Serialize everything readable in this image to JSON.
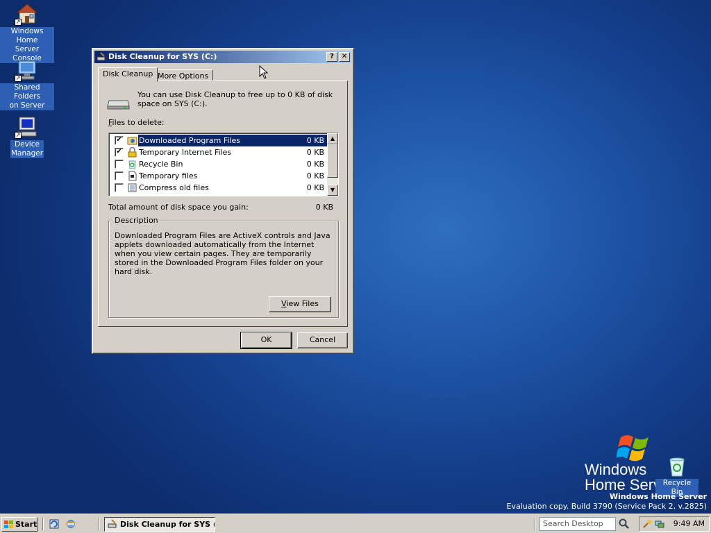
{
  "desktop": {
    "icons": [
      {
        "label_line1": "Windows Home",
        "label_line2": "Server Console"
      },
      {
        "label_line1": "Shared Folders",
        "label_line2": "on Server"
      },
      {
        "label_line1": "Device",
        "label_line2": "Manager"
      }
    ],
    "recycle_bin_label": "Recycle Bin",
    "brand": {
      "windows": "Windows",
      "home_server": "Home Server",
      "product": "Windows Home Server",
      "build": "Evaluation copy. Build 3790 (Service Pack 2, v.2825)"
    }
  },
  "dialog": {
    "title": "Disk Cleanup for SYS (C:)",
    "help_button": "?",
    "close_button": "✕",
    "tabs": [
      {
        "label": "Disk Cleanup",
        "active": true
      },
      {
        "label": "More Options",
        "active": false
      }
    ],
    "intro_text": "You can use Disk Cleanup to free up to 0 KB of disk space on SYS (C:).",
    "files_label": "Files to delete:",
    "files": [
      {
        "name": "Downloaded Program Files",
        "size": "0 KB",
        "checked": true,
        "selected": true
      },
      {
        "name": "Temporary Internet Files",
        "size": "0 KB",
        "checked": true,
        "selected": false
      },
      {
        "name": "Recycle Bin",
        "size": "0 KB",
        "checked": false,
        "selected": false
      },
      {
        "name": "Temporary files",
        "size": "0 KB",
        "checked": false,
        "selected": false
      },
      {
        "name": "Compress old files",
        "size": "0 KB",
        "checked": false,
        "selected": false
      }
    ],
    "total_label": "Total amount of disk space you gain:",
    "total_value": "0 KB",
    "description_legend": "Description",
    "description_text": "Downloaded Program Files are ActiveX controls and Java applets downloaded automatically from the Internet when you view certain pages. They are temporarily stored in the Downloaded Program Files folder on your hard disk.",
    "view_files_button": "View Files",
    "ok_button": "OK",
    "cancel_button": "Cancel"
  },
  "taskbar": {
    "start_label": "Start",
    "task_label": "Disk Cleanup for SYS (...",
    "search_placeholder": "Search Desktop",
    "clock": "9:49 AM"
  }
}
